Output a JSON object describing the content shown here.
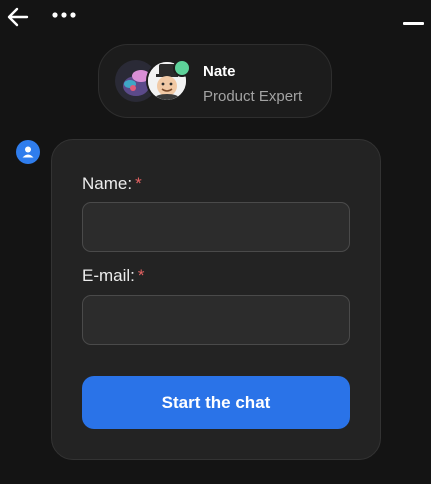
{
  "header": {
    "back_icon": "arrow-left-icon",
    "more_icon": "more-horizontal-icon",
    "minimize_icon": "minimize-icon"
  },
  "agent": {
    "name": "Nate",
    "role": "Product Expert",
    "status_color": "#5ed29a"
  },
  "form": {
    "name_label": "Name:",
    "email_label": "E-mail:",
    "required_marker": "*",
    "name_value": "",
    "email_value": "",
    "submit_label": "Start the chat"
  },
  "colors": {
    "background": "#141414",
    "card": "#232323",
    "accent": "#2a73e8",
    "required": "#e46262"
  }
}
